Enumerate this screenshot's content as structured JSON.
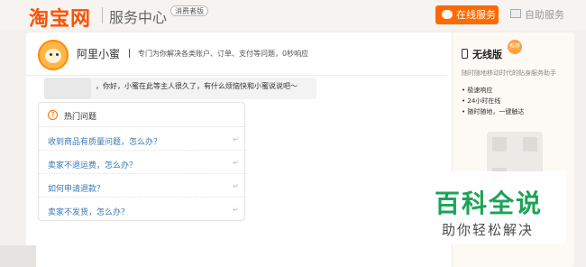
{
  "header": {
    "logo": "淘宝网",
    "title": "服务中心",
    "badge": "消费者版",
    "online_service": "在线服务",
    "self_service": "自助服务"
  },
  "agent": {
    "name": "阿里小蜜",
    "description": "专门为你解决各类账户、订单、支付等问题，0秒响应"
  },
  "chat": {
    "greeting": "，你好，小蜜在此等主人很久了，有什么烦恼快和小蜜说说吧～"
  },
  "faq": {
    "title": "热门问题",
    "items": [
      "收到商品有质量问题，怎么办？",
      "卖家不退运费，怎么办？",
      "如何申请退款？",
      "卖家不发货，怎么办？"
    ]
  },
  "side": {
    "title": "无线版",
    "badge": "推荐",
    "subtitle": "随时随地移动时代的贴身服务助手",
    "bullets": [
      "极速响应",
      "24小时在线",
      "随时随地，一键触达"
    ]
  },
  "watermark": {
    "title": "百科全说",
    "subtitle": "助你轻松解决"
  },
  "colors": {
    "brand": "#ff5000",
    "link": "#3a78b5",
    "watermark": "#12a150"
  }
}
